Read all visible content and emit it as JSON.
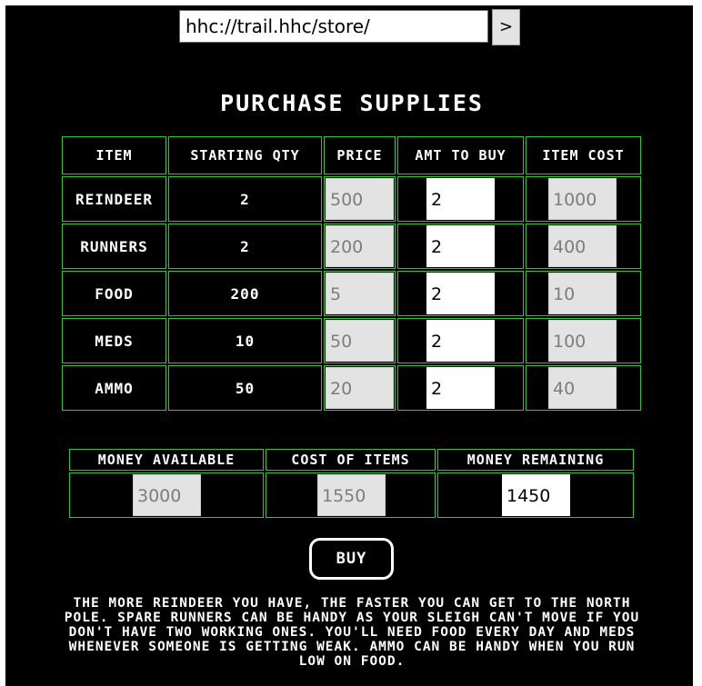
{
  "address_bar": {
    "url": "hhc://trail.hhc/store/",
    "go_label": ">"
  },
  "title": "PURCHASE SUPPLIES",
  "table": {
    "headers": [
      "ITEM",
      "STARTING QTY",
      "PRICE",
      "AMT TO BUY",
      "ITEM COST"
    ],
    "rows": [
      {
        "item": "REINDEER",
        "qty": "2",
        "price": "500",
        "amt": "2",
        "cost": "1000"
      },
      {
        "item": "RUNNERS",
        "qty": "2",
        "price": "200",
        "amt": "2",
        "cost": "400"
      },
      {
        "item": "FOOD",
        "qty": "200",
        "price": "5",
        "amt": "2",
        "cost": "10"
      },
      {
        "item": "MEDS",
        "qty": "10",
        "price": "50",
        "amt": "2",
        "cost": "100"
      },
      {
        "item": "AMMO",
        "qty": "50",
        "price": "20",
        "amt": "2",
        "cost": "40"
      }
    ]
  },
  "totals": {
    "money_available_label": "MONEY AVAILABLE",
    "cost_of_items_label": "COST OF ITEMS",
    "money_remaining_label": "MONEY REMAINING",
    "money_available": "3000",
    "cost_of_items": "1550",
    "money_remaining": "1450"
  },
  "buy_label": "BUY",
  "description": "THE MORE REINDEER YOU HAVE, THE FASTER YOU CAN GET TO THE NORTH POLE. SPARE RUNNERS CAN BE HANDY AS YOUR SLEIGH CAN'T MOVE IF YOU DON'T HAVE TWO WORKING ONES. YOU'LL NEED FOOD EVERY DAY AND MEDS WHENEVER SOMEONE IS GETTING WEAK. AMMO CAN BE HANDY WHEN YOU RUN LOW ON FOOD."
}
